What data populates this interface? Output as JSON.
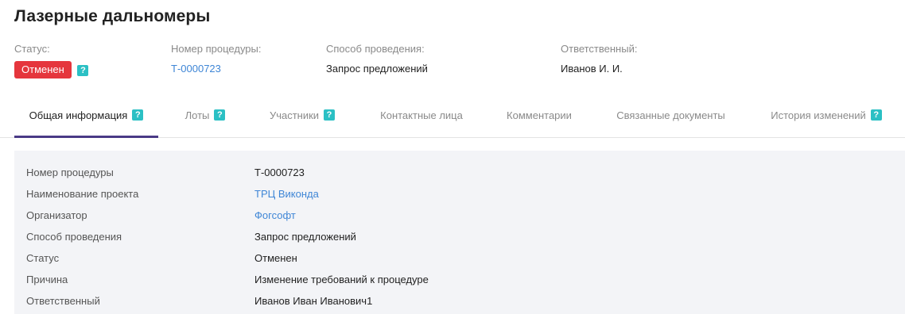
{
  "page": {
    "title": "Лазерные дальномеры"
  },
  "meta": {
    "status": {
      "label": "Статус:",
      "value": "Отменен",
      "badge_color": "#e5363d"
    },
    "procedure_number": {
      "label": "Номер процедуры:",
      "value": "Т-0000723"
    },
    "method": {
      "label": "Способ проведения:",
      "value": "Запрос предложений"
    },
    "responsible": {
      "label": "Ответственный:",
      "value": "Иванов И. И."
    }
  },
  "help_icon_glyph": "?",
  "tabs": [
    {
      "label": "Общая информация",
      "active": true,
      "has_help": true
    },
    {
      "label": "Лоты",
      "active": false,
      "has_help": true
    },
    {
      "label": "Участники",
      "active": false,
      "has_help": true
    },
    {
      "label": "Контактные лица",
      "active": false,
      "has_help": false
    },
    {
      "label": "Комментарии",
      "active": false,
      "has_help": false
    },
    {
      "label": "Связанные документы",
      "active": false,
      "has_help": false
    },
    {
      "label": "История изменений",
      "active": false,
      "has_help": true
    }
  ],
  "general_info": [
    {
      "label": "Номер процедуры",
      "value": "Т-0000723",
      "link": false
    },
    {
      "label": "Наименование проекта",
      "value": "ТРЦ Виконда",
      "link": true
    },
    {
      "label": "Организатор",
      "value": "Фогсофт",
      "link": true
    },
    {
      "label": "Способ проведения",
      "value": "Запрос предложений",
      "link": false
    },
    {
      "label": "Статус",
      "value": "Отменен",
      "link": false
    },
    {
      "label": "Причина",
      "value": "Изменение требований к процедуре",
      "link": false
    },
    {
      "label": "Ответственный",
      "value": "Иванов Иван Иванович1",
      "link": false
    }
  ],
  "colors": {
    "accent": "#4a3a86",
    "link": "#3f86d6",
    "help_icon": "#2bc0c4",
    "panel_bg": "#f3f4f7"
  }
}
